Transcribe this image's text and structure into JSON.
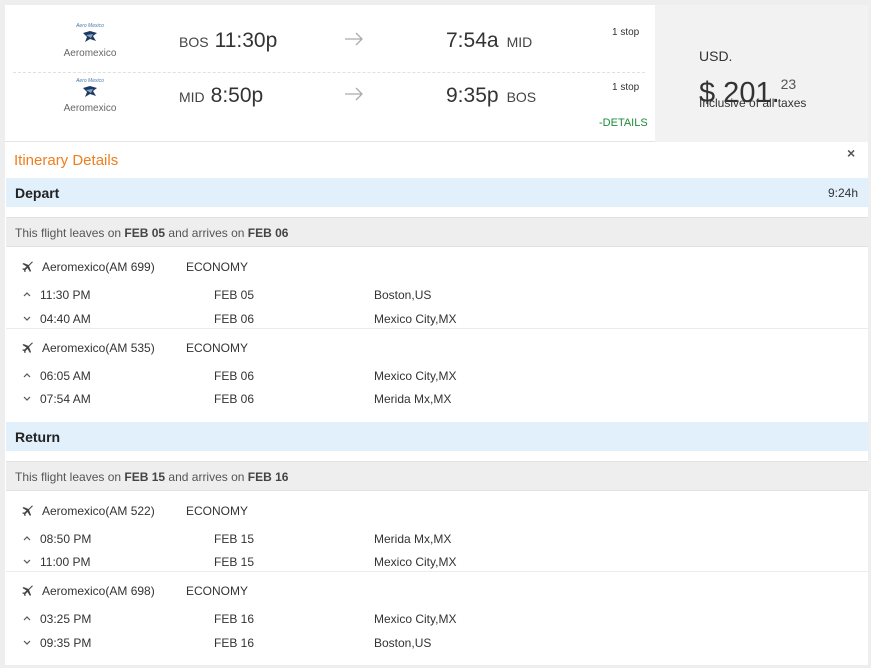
{
  "summary": {
    "legs": [
      {
        "airline_logo_text": "Aero Mexico",
        "airline_name": "Aeromexico",
        "dep_code": "BOS",
        "dep_time": "11:30p",
        "arr_time": "7:54a",
        "arr_code": "MID",
        "stops": "1 stop"
      },
      {
        "airline_logo_text": "Aero Mexico",
        "airline_name": "Aeromexico",
        "dep_code": "MID",
        "dep_time": "8:50p",
        "arr_time": "9:35p",
        "arr_code": "BOS",
        "stops": "1 stop"
      }
    ],
    "details_link": "-DETAILS",
    "price": {
      "currency": "USD.",
      "main": "$ 201.",
      "cents": "23",
      "note": "Inclusive of all taxes"
    }
  },
  "itinerary": {
    "title": "Itinerary Details",
    "close_symbol": "×",
    "depart": {
      "label": "Depart",
      "duration": "9:24h",
      "leaves": {
        "pre": "This flight leaves on ",
        "from_date": "FEB 05",
        "mid": " and arrives on ",
        "to_date": "FEB 06"
      },
      "segments": [
        {
          "flight": "Aeromexico(AM 699)",
          "cabin": "ECONOMY",
          "from": {
            "time": "11:30 PM",
            "date": "FEB 05",
            "place": "Boston,US"
          },
          "to": {
            "time": "04:40 AM",
            "date": "FEB 06",
            "place": "Mexico City,MX"
          }
        },
        {
          "flight": "Aeromexico(AM 535)",
          "cabin": "ECONOMY",
          "from": {
            "time": "06:05 AM",
            "date": "FEB 06",
            "place": "Mexico City,MX"
          },
          "to": {
            "time": "07:54 AM",
            "date": "FEB 06",
            "place": "Merida Mx,MX"
          }
        }
      ]
    },
    "return": {
      "label": "Return",
      "leaves": {
        "pre": "This flight leaves on ",
        "from_date": "FEB 15",
        "mid": " and arrives on ",
        "to_date": "FEB 16"
      },
      "segments": [
        {
          "flight": "Aeromexico(AM 522)",
          "cabin": "ECONOMY",
          "from": {
            "time": "08:50 PM",
            "date": "FEB 15",
            "place": "Merida Mx,MX"
          },
          "to": {
            "time": "11:00 PM",
            "date": "FEB 15",
            "place": "Mexico City,MX"
          }
        },
        {
          "flight": "Aeromexico(AM 698)",
          "cabin": "ECONOMY",
          "from": {
            "time": "03:25 PM",
            "date": "FEB 16",
            "place": "Mexico City,MX"
          },
          "to": {
            "time": "09:35 PM",
            "date": "FEB 16",
            "place": "Boston,US"
          }
        }
      ]
    }
  },
  "colors": {
    "accent_orange": "#f07e1c",
    "section_blue": "#e1f0fb",
    "details_green": "#1e8a3c"
  }
}
